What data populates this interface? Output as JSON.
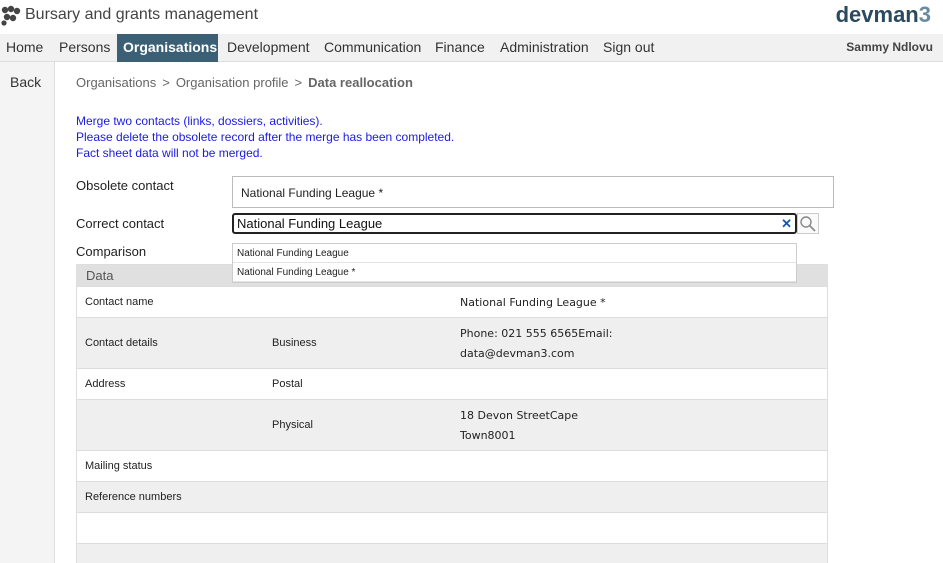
{
  "app": {
    "title": "Bursary and grants management",
    "brand": "devman",
    "brand_suffix": "3"
  },
  "nav": {
    "items": [
      "Home",
      "Persons",
      "Organisations",
      "Development",
      "Communication",
      "Finance",
      "Administration",
      "Sign out"
    ],
    "active": "Organisations",
    "user": "Sammy Ndlovu"
  },
  "sidebar": {
    "back_label": "Back"
  },
  "breadcrumb": {
    "items": [
      "Organisations",
      "Organisation profile"
    ],
    "current": "Data reallocation",
    "separator": ">"
  },
  "info": {
    "line1": "Merge two contacts (links, dossiers, activities).",
    "line2": "Please delete the obsolete record after the merge has been completed.",
    "line3": "Fact sheet data will not be merged."
  },
  "form": {
    "obsolete_label": "Obsolete contact",
    "obsolete_value": "National Funding League *",
    "correct_label": "Correct contact",
    "correct_value": "National Funding League",
    "comparison_label": "Comparison"
  },
  "dropdown": {
    "options": [
      "National Funding League",
      "National Funding League *"
    ]
  },
  "table": {
    "header": "Data",
    "rows": [
      {
        "label": "Contact name",
        "sub": "",
        "value1": "National Funding League *",
        "value2": ""
      },
      {
        "label": "Contact details",
        "sub": "Business",
        "value1": "Phone: 021 555 6565Email:",
        "value2": "data@devman3.com"
      },
      {
        "label": "Address",
        "sub": "Postal",
        "value1": "",
        "value2": ""
      },
      {
        "label": "",
        "sub": "Physical",
        "value1": "18 Devon StreetCape",
        "value2": "Town8001"
      },
      {
        "label": "Mailing status",
        "sub": "",
        "value1": "",
        "value2": ""
      },
      {
        "label": "Reference numbers",
        "sub": "",
        "value1": "",
        "value2": ""
      }
    ]
  },
  "colors": {
    "nav_active": "#3b5f74",
    "info_text": "#1a1ae6",
    "brand": "#2c4a5e"
  },
  "icons": {
    "logo": "app-logo-icon",
    "clear": "close-icon",
    "search": "search-icon"
  }
}
